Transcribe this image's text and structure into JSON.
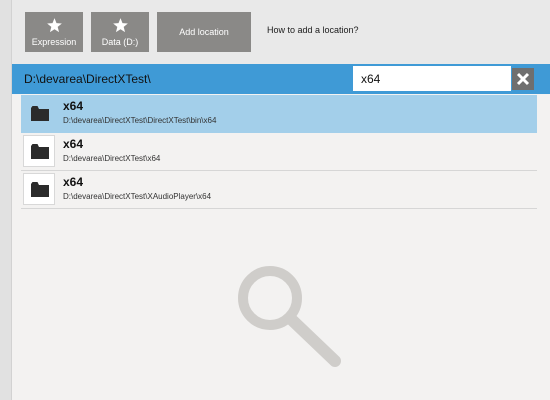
{
  "toolbar": {
    "buttons": [
      {
        "label": "Expression",
        "icon": "star-icon"
      },
      {
        "label": "Data (D:)",
        "icon": "star-icon"
      },
      {
        "label": "Add location"
      }
    ],
    "help_link": "How to add a location?"
  },
  "pathbar": {
    "path": "D:\\devarea\\DirectXTest\\",
    "search_value": "x64",
    "clear_icon": "close-icon"
  },
  "results": [
    {
      "name": "x64",
      "path": "D:\\devarea\\DirectXTest\\DirectXTest\\bin\\x64",
      "icon": "folder-icon",
      "selected": true
    },
    {
      "name": "x64",
      "path": "D:\\devarea\\DirectXTest\\x64",
      "icon": "folder-icon",
      "selected": false
    },
    {
      "name": "x64",
      "path": "D:\\devarea\\DirectXTest\\XAudioPlayer\\x64",
      "icon": "folder-icon",
      "selected": false
    }
  ],
  "watermark_icon": "search-icon",
  "colors": {
    "accent": "#3f9ad6",
    "selected_row": "#a3cfea",
    "tile": "#8a8987",
    "background": "#f3f2f1"
  }
}
